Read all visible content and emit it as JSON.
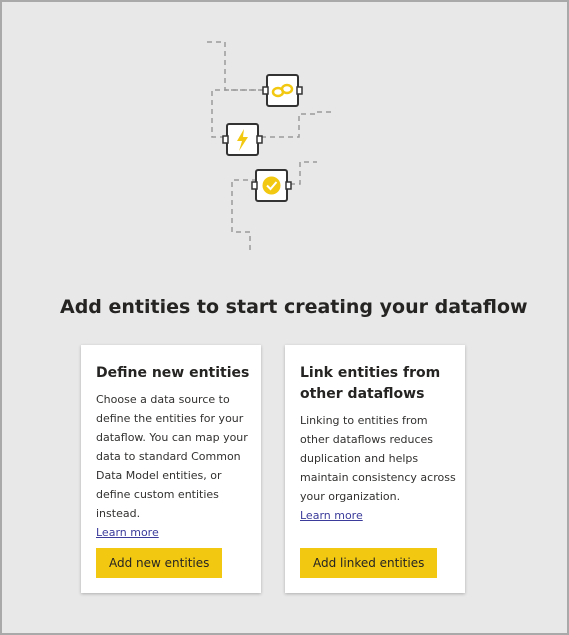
{
  "colors": {
    "accent": "#f2c811",
    "panel_bg": "#e8e8e8",
    "text": "#252423",
    "link": "#3b3b9b"
  },
  "illustration": {
    "icons": [
      "link-icon",
      "lightning-icon",
      "check-badge-icon"
    ]
  },
  "heading": "Add entities to start creating your dataflow",
  "cards": [
    {
      "title": "Define new entities",
      "description": "Choose a data source to define the entities for your dataflow. You can map your data to standard Common Data Model entities, or define custom entities instead.",
      "link": "Learn more",
      "button": "Add new entities"
    },
    {
      "title": "Link entities from other dataflows",
      "description": "Linking to entities from other dataflows reduces duplication and helps maintain consistency across your organization.",
      "link": "Learn more",
      "button": "Add linked entities"
    }
  ]
}
